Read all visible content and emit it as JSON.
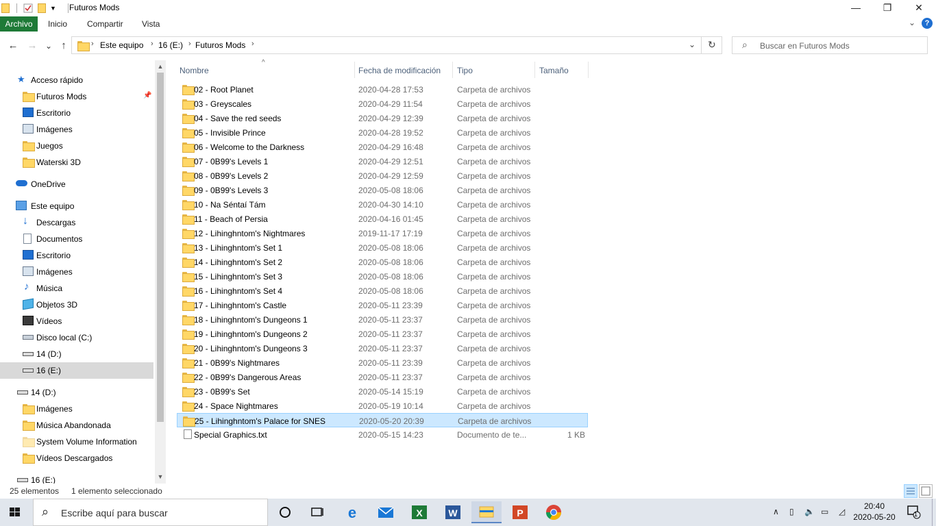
{
  "window": {
    "title": "Futuros Mods",
    "controls": {
      "minimize": "—",
      "maximize": "❐",
      "close": "✕"
    }
  },
  "ribbon": {
    "tabs": [
      "Archivo",
      "Inicio",
      "Compartir",
      "Vista"
    ]
  },
  "navigation": {
    "back": "←",
    "forward": "→",
    "recent": "⌄",
    "up": "↑",
    "breadcrumb": [
      "Este equipo",
      "16 (E:)",
      "Futuros Mods"
    ],
    "refresh": "↻",
    "search_placeholder": "Buscar en Futuros Mods"
  },
  "sidebar": {
    "quick_access": "Acceso rápido",
    "quick_items": [
      "Futuros Mods",
      "Escritorio",
      "Imágenes",
      "Juegos",
      "Waterski 3D"
    ],
    "onedrive": "OneDrive",
    "this_pc": "Este equipo",
    "pc_items": [
      "Descargas",
      "Documentos",
      "Escritorio",
      "Imágenes",
      "Música",
      "Objetos 3D",
      "Vídeos",
      "Disco local (C:)",
      "14 (D:)",
      "16 (E:)"
    ],
    "drive_d": "14 (D:)",
    "drive_d_items": [
      "Imágenes",
      "Música Abandonada",
      "System Volume Information",
      "Vídeos Descargados"
    ],
    "drive_e": "16 (E:)"
  },
  "columns": {
    "name": "Nombre",
    "date": "Fecha de modificación",
    "type": "Tipo",
    "size": "Tamaño"
  },
  "files": [
    {
      "name": "02 - Root Planet",
      "date": "2020-04-28 17:53",
      "type": "Carpeta de archivos",
      "size": "",
      "kind": "folder"
    },
    {
      "name": "03 - Greyscales",
      "date": "2020-04-29 11:54",
      "type": "Carpeta de archivos",
      "size": "",
      "kind": "folder"
    },
    {
      "name": "04 - Save the red seeds",
      "date": "2020-04-29 12:39",
      "type": "Carpeta de archivos",
      "size": "",
      "kind": "folder"
    },
    {
      "name": "05 - Invisible Prince",
      "date": "2020-04-28 19:52",
      "type": "Carpeta de archivos",
      "size": "",
      "kind": "folder"
    },
    {
      "name": "06 - Welcome to the Darkness",
      "date": "2020-04-29 16:48",
      "type": "Carpeta de archivos",
      "size": "",
      "kind": "folder"
    },
    {
      "name": "07 - 0B99's Levels 1",
      "date": "2020-04-29 12:51",
      "type": "Carpeta de archivos",
      "size": "",
      "kind": "folder"
    },
    {
      "name": "08 - 0B99's Levels 2",
      "date": "2020-04-29 12:59",
      "type": "Carpeta de archivos",
      "size": "",
      "kind": "folder"
    },
    {
      "name": "09 - 0B99's Levels 3",
      "date": "2020-05-08 18:06",
      "type": "Carpeta de archivos",
      "size": "",
      "kind": "folder"
    },
    {
      "name": "10 - Na Séntaí Tám",
      "date": "2020-04-30 14:10",
      "type": "Carpeta de archivos",
      "size": "",
      "kind": "folder"
    },
    {
      "name": "11 - Beach of Persia",
      "date": "2020-04-16 01:45",
      "type": "Carpeta de archivos",
      "size": "",
      "kind": "folder"
    },
    {
      "name": "12 - Lihinghntom's Nightmares",
      "date": "2019-11-17 17:19",
      "type": "Carpeta de archivos",
      "size": "",
      "kind": "folder"
    },
    {
      "name": "13 - Lihinghntom's Set 1",
      "date": "2020-05-08 18:06",
      "type": "Carpeta de archivos",
      "size": "",
      "kind": "folder"
    },
    {
      "name": "14 - Lihinghntom's Set 2",
      "date": "2020-05-08 18:06",
      "type": "Carpeta de archivos",
      "size": "",
      "kind": "folder"
    },
    {
      "name": "15 - Lihinghntom's Set 3",
      "date": "2020-05-08 18:06",
      "type": "Carpeta de archivos",
      "size": "",
      "kind": "folder"
    },
    {
      "name": "16 - Lihinghntom's Set 4",
      "date": "2020-05-08 18:06",
      "type": "Carpeta de archivos",
      "size": "",
      "kind": "folder"
    },
    {
      "name": "17 - Lihinghntom's Castle",
      "date": "2020-05-11 23:39",
      "type": "Carpeta de archivos",
      "size": "",
      "kind": "folder"
    },
    {
      "name": "18 - Lihinghntom's Dungeons 1",
      "date": "2020-05-11 23:37",
      "type": "Carpeta de archivos",
      "size": "",
      "kind": "folder"
    },
    {
      "name": "19 - Lihinghntom's Dungeons 2",
      "date": "2020-05-11 23:37",
      "type": "Carpeta de archivos",
      "size": "",
      "kind": "folder"
    },
    {
      "name": "20 - Lihinghntom's Dungeons 3",
      "date": "2020-05-11 23:37",
      "type": "Carpeta de archivos",
      "size": "",
      "kind": "folder"
    },
    {
      "name": "21 - 0B99's Nightmares",
      "date": "2020-05-11 23:39",
      "type": "Carpeta de archivos",
      "size": "",
      "kind": "folder"
    },
    {
      "name": "22 - 0B99's Dangerous Areas",
      "date": "2020-05-11 23:37",
      "type": "Carpeta de archivos",
      "size": "",
      "kind": "folder"
    },
    {
      "name": "23 - 0B99's Set",
      "date": "2020-05-14 15:19",
      "type": "Carpeta de archivos",
      "size": "",
      "kind": "folder"
    },
    {
      "name": "24 - Space Nightmares",
      "date": "2020-05-19 10:14",
      "type": "Carpeta de archivos",
      "size": "",
      "kind": "folder"
    },
    {
      "name": "25 - Lihinghntom's Palace for SNES",
      "date": "2020-05-20 20:39",
      "type": "Carpeta de archivos",
      "size": "",
      "kind": "folder",
      "selected": true
    },
    {
      "name": "Special Graphics.txt",
      "date": "2020-05-15 14:23",
      "type": "Documento de te...",
      "size": "1 KB",
      "kind": "txt"
    }
  ],
  "status": {
    "count": "25 elementos",
    "selection": "1 elemento seleccionado"
  },
  "taskbar": {
    "search_placeholder": "Escribe aquí para buscar",
    "time": "20:40",
    "date": "2020-05-20",
    "notification_count": "1"
  }
}
